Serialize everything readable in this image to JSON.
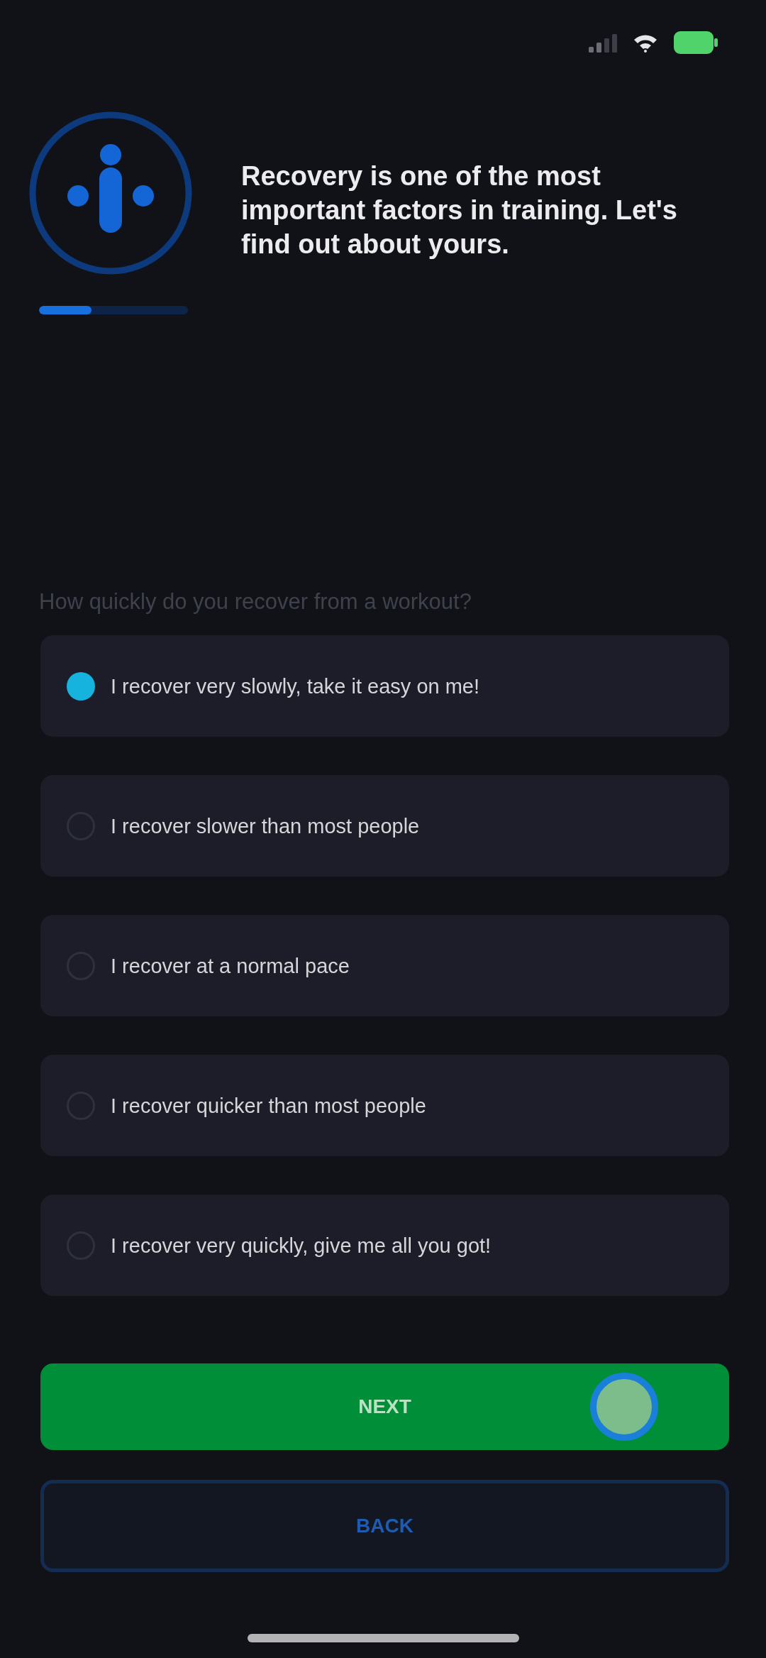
{
  "header": {
    "title": "Recovery is one of the most important factors in training. Let's find out about yours.",
    "progress": {
      "level": 0.35
    }
  },
  "question": {
    "prompt": "How quickly do you recover from a workout?",
    "options": [
      {
        "label": "I recover very slowly, take it easy on me!",
        "selected": true
      },
      {
        "label": "I recover slower than most people",
        "selected": false
      },
      {
        "label": "I recover at a normal pace",
        "selected": false
      },
      {
        "label": "I recover quicker than most people",
        "selected": false
      },
      {
        "label": "I recover very quickly, give me all you got!",
        "selected": false
      }
    ]
  },
  "buttons": [
    {
      "kind": "primary",
      "label": "NEXT",
      "touched": true
    },
    {
      "kind": "secondary",
      "label": "BACK",
      "touched": false
    }
  ]
}
